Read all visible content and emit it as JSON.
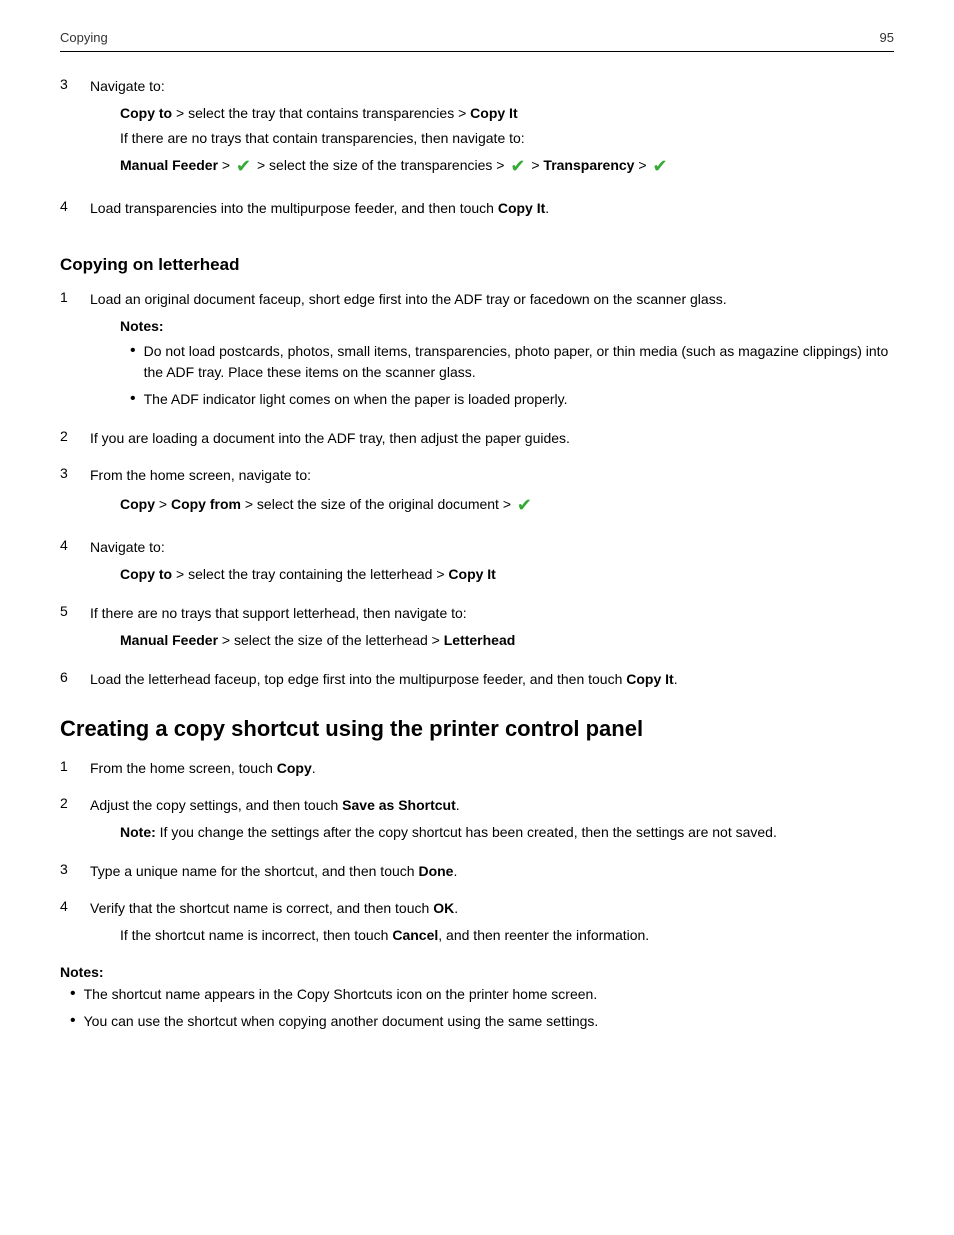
{
  "header": {
    "title": "Copying",
    "page_number": "95"
  },
  "section_transparencies": {
    "step3": {
      "num": "3",
      "label": "Navigate to:",
      "line1_pre": "Copy to",
      "line1_mid": " > select the tray that contains transparencies > ",
      "line1_bold": "Copy It",
      "line2": "If there are no trays that contain transparencies, then navigate to:",
      "line3_bold1": "Manual Feeder",
      "line3_mid1": " > ",
      "line3_mid2": " > select the size of the transparencies > ",
      "line3_mid3": " > ",
      "line3_bold2": "Transparency",
      "line3_mid4": " > "
    },
    "step4": {
      "num": "4",
      "text_pre": "Load transparencies into the multipurpose feeder, and then touch ",
      "text_bold": "Copy It",
      "text_end": "."
    }
  },
  "section_letterhead": {
    "heading": "Copying on letterhead",
    "step1": {
      "num": "1",
      "text": "Load an original document faceup, short edge first into the ADF tray or facedown on the scanner glass."
    },
    "notes_label": "Notes:",
    "notes": [
      "Do not load postcards, photos, small items, transparencies, photo paper, or thin media (such as magazine clippings) into the ADF tray. Place these items on the scanner glass.",
      "The ADF indicator light comes on when the paper is loaded properly."
    ],
    "step2": {
      "num": "2",
      "text": "If you are loading a document into the ADF tray, then adjust the paper guides."
    },
    "step3": {
      "num": "3",
      "text_pre": "From the home screen, navigate to:"
    },
    "step3_indent": {
      "bold1": "Copy",
      "mid1": " > ",
      "bold2": "Copy from",
      "mid2": " > select the size of the original document > "
    },
    "step4": {
      "num": "4",
      "text": "Navigate to:"
    },
    "step4_indent": {
      "bold1": "Copy to",
      "mid1": " > select the tray containing the letterhead > ",
      "bold2": "Copy It"
    },
    "step5": {
      "num": "5",
      "text_pre": "If there are no trays that support letterhead, then navigate to:"
    },
    "step5_indent": {
      "bold1": "Manual Feeder",
      "mid1": " > select the size of the letterhead > ",
      "bold2": "Letterhead"
    },
    "step6": {
      "num": "6",
      "text_pre": "Load the letterhead faceup, top edge first into the multipurpose feeder, and then touch ",
      "text_bold": "Copy It",
      "text_end": "."
    }
  },
  "section_shortcut": {
    "heading": "Creating a copy shortcut using the printer control panel",
    "step1": {
      "num": "1",
      "text_pre": "From the home screen, touch ",
      "text_bold": "Copy",
      "text_end": "."
    },
    "step2": {
      "num": "2",
      "text_pre": "Adjust the copy settings, and then touch ",
      "text_bold": "Save as Shortcut",
      "text_end": "."
    },
    "step2_note": {
      "bold": "Note:",
      "text": " If you change the settings after the copy shortcut has been created, then the settings are not saved."
    },
    "step3": {
      "num": "3",
      "text_pre": "Type a unique name for the shortcut, and then touch ",
      "text_bold": "Done",
      "text_end": "."
    },
    "step4": {
      "num": "4",
      "text_pre": "Verify that the shortcut name is correct, and then touch ",
      "text_bold": "OK",
      "text_end": "."
    },
    "step4_indent": {
      "text_pre": "If the shortcut name is incorrect, then touch ",
      "text_bold": "Cancel",
      "text_mid": ", and then reenter the information."
    },
    "notes_label": "Notes:",
    "notes": [
      "The shortcut name appears in the Copy Shortcuts icon on the printer home screen.",
      "You can use the shortcut when copying another document using the same settings."
    ]
  }
}
